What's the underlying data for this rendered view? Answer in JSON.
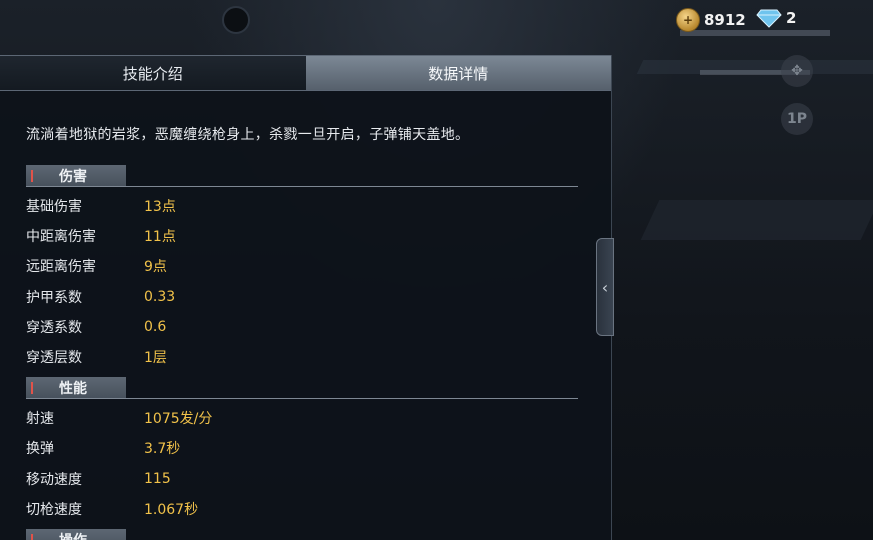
{
  "currencies": {
    "gold": {
      "icon": "gold-coin-icon",
      "value": "8912",
      "color": "#d3a347"
    },
    "gem": {
      "icon": "diamond-icon",
      "value": "2",
      "color": "#6fc4ee"
    }
  },
  "side_buttons": [
    {
      "icon": "settings-icon",
      "label": ""
    },
    {
      "icon": "player-icon",
      "label": "1P"
    }
  ],
  "tabs": [
    {
      "label": "技能介绍",
      "active": false
    },
    {
      "label": "数据详情",
      "active": true
    }
  ],
  "description": "流淌着地狱的岩浆，恶魔缠绕枪身上，杀戮一旦开启，子弹铺天盖地。",
  "sections": {
    "damage": {
      "title": "伤害",
      "rows": [
        {
          "label": "基础伤害",
          "value": "13点"
        },
        {
          "label": "中距离伤害",
          "value": "11点"
        },
        {
          "label": "远距离伤害",
          "value": "9点"
        },
        {
          "label": "护甲系数",
          "value": "0.33"
        },
        {
          "label": "穿透系数",
          "value": "0.6"
        },
        {
          "label": "穿透层数",
          "value": "1层"
        }
      ]
    },
    "performance": {
      "title": "性能",
      "rows": [
        {
          "label": "射速",
          "value": "1075发/分"
        },
        {
          "label": "换弹",
          "value": "3.7秒"
        },
        {
          "label": "移动速度",
          "value": "115"
        },
        {
          "label": "切枪速度",
          "value": "1.067秒"
        }
      ]
    },
    "operation": {
      "title": "操作"
    }
  },
  "collapse_handle": {
    "icon": "chevron-left-icon",
    "glyph": "‹"
  },
  "colors": {
    "value_accent": "#f1c24a",
    "section_marker": "#e0534a"
  }
}
